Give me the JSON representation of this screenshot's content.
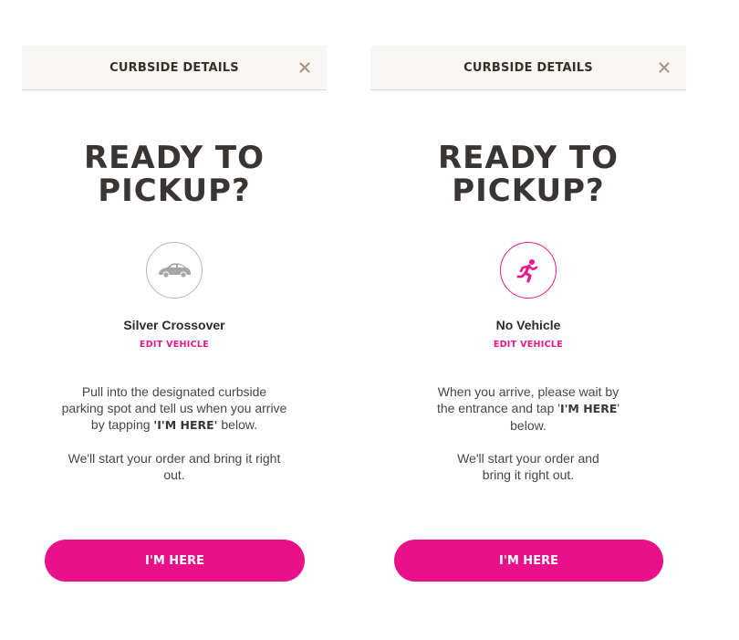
{
  "colors": {
    "accent": "#e8118a",
    "header_bg": "#f8f6f3",
    "close_icon": "#b09480"
  },
  "screens": [
    {
      "header_title": "CURBSIDE DETAILS",
      "close_icon": "close-icon",
      "heading_line1": "READY TO",
      "heading_line2": "PICKUP?",
      "vehicle_icon": "car-icon",
      "vehicle_name": "Silver Crossover",
      "edit_label": "EDIT VEHICLE",
      "desc_pre": "Pull into the designated curbside parking spot and tell us when you arrive by tapping ",
      "desc_bold": "'I'M HERE'",
      "desc_post": " below.",
      "desc2": "We'll start your order and bring it right out.",
      "cta_label": "I'M HERE"
    },
    {
      "header_title": "CURBSIDE DETAILS",
      "close_icon": "close-icon",
      "heading_line1": "READY TO",
      "heading_line2": "PICKUP?",
      "vehicle_icon": "running-person-icon",
      "vehicle_name": "No Vehicle",
      "edit_label": "EDIT VEHICLE",
      "desc_pre": "When you arrive, please wait by the entrance and tap '",
      "desc_bold": "I'M HERE",
      "desc_post": "' below.",
      "desc2": "We'll start your order and bring it right out.",
      "cta_label": "I'M HERE"
    }
  ]
}
